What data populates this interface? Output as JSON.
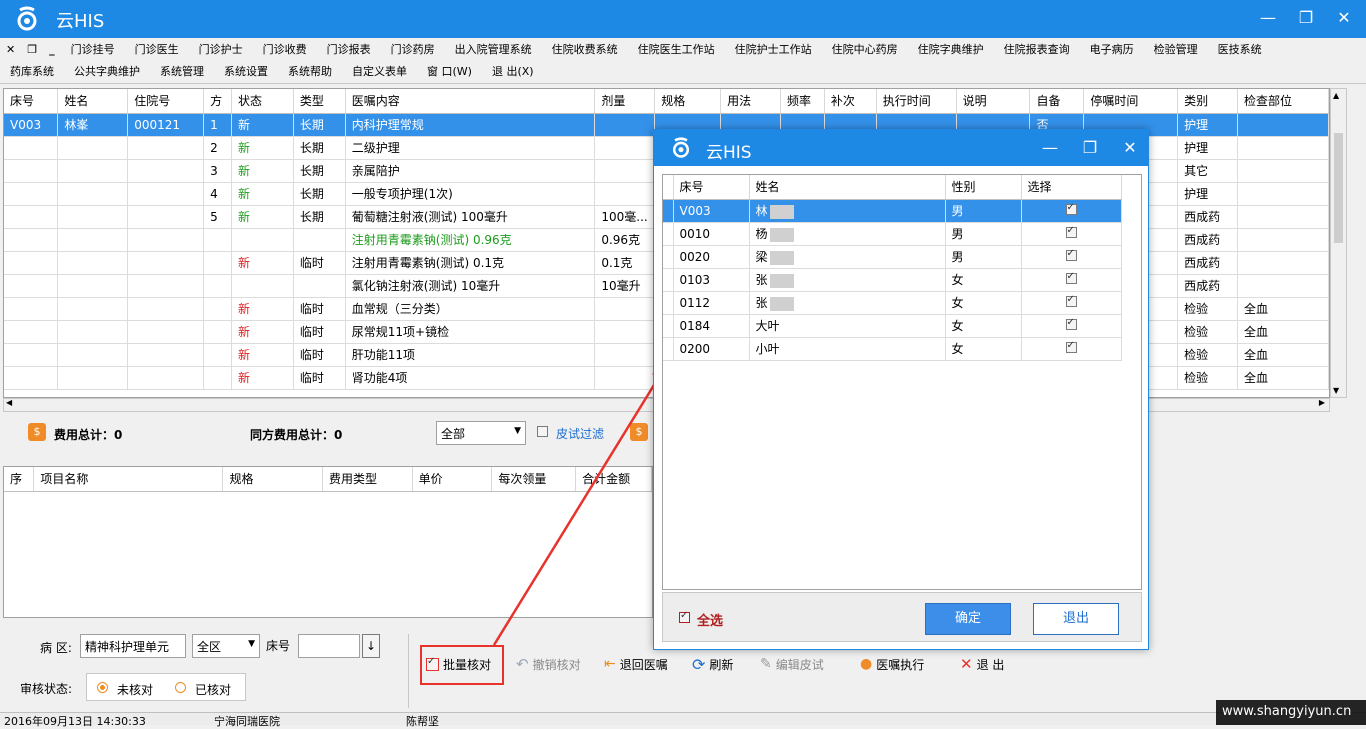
{
  "app": {
    "title": "云HIS"
  },
  "menu": {
    "row1": [
      "门诊挂号",
      "门诊医生",
      "门诊护士",
      "门诊收费",
      "门诊报表",
      "门诊药房",
      "出入院管理系统",
      "住院收费系统",
      "住院医生工作站",
      "住院护士工作站",
      "住院中心药房",
      "住院字典维护",
      "住院报表查询",
      "电子病历",
      "检验管理",
      "医技系统"
    ],
    "row2": [
      "药库系统",
      "公共字典维护",
      "系统管理",
      "系统设置",
      "系统帮助",
      "自定义表单",
      "窗  口(W)",
      "退  出(X)"
    ]
  },
  "orders": {
    "columns": [
      "床号",
      "姓名",
      "住院号",
      "方",
      "状态",
      "类型",
      "医嘱内容",
      "剂量",
      "规格",
      "用法",
      "频率",
      "补次",
      "执行时间",
      "说明",
      "自备",
      "停嘱时间",
      "类别",
      "检查部位"
    ],
    "rows": [
      [
        "V003",
        "林峯",
        "000121",
        "1",
        "新",
        "长期",
        "内科护理常规",
        "",
        "",
        "",
        "",
        "",
        "",
        "",
        "否",
        "",
        "护理",
        ""
      ],
      [
        "",
        "",
        "",
        "2",
        "新",
        "长期",
        "二级护理",
        "",
        "",
        "",
        "",
        "",
        "",
        "",
        "",
        "",
        "护理",
        ""
      ],
      [
        "",
        "",
        "",
        "3",
        "新",
        "长期",
        "亲属陪护",
        "",
        "",
        "",
        "",
        "",
        "",
        "",
        "",
        "",
        "其它",
        ""
      ],
      [
        "",
        "",
        "",
        "4",
        "新",
        "长期",
        "一般专项护理(1次)",
        "",
        "",
        "",
        "",
        "",
        "",
        "",
        "",
        "",
        "护理",
        ""
      ],
      [
        "",
        "",
        "",
        "5",
        "新",
        "长期",
        "葡萄糖注射液(测试) 100毫升",
        "100毫...",
        "",
        "",
        "",
        "",
        "",
        "",
        "",
        "",
        "西成药",
        ""
      ],
      [
        "",
        "",
        "",
        "",
        "",
        "",
        "注射用青霉素钠(测试) 0.96克",
        "0.96克",
        "",
        "",
        "",
        "",
        "",
        "",
        "",
        "",
        "西成药",
        ""
      ],
      [
        "",
        "",
        "",
        "",
        "新",
        "临时",
        "注射用青霉素钠(测试) 0.1克",
        "0.1克",
        "",
        "",
        "",
        "",
        "",
        "",
        "",
        "",
        "西成药",
        ""
      ],
      [
        "",
        "",
        "",
        "",
        "",
        "",
        "氯化钠注射液(测试) 10毫升",
        "10毫升",
        "",
        "",
        "",
        "",
        "",
        "",
        "",
        "",
        "西成药",
        ""
      ],
      [
        "",
        "",
        "",
        "",
        "新",
        "临时",
        "血常规（三分类）",
        "",
        "",
        "",
        "",
        "",
        "",
        "",
        "",
        "",
        "检验",
        "全血"
      ],
      [
        "",
        "",
        "",
        "",
        "新",
        "临时",
        "尿常规11项+镜检",
        "",
        "",
        "",
        "",
        "",
        "",
        "",
        "",
        "",
        "检验",
        "全血"
      ],
      [
        "",
        "",
        "",
        "",
        "新",
        "临时",
        "肝功能11项",
        "",
        "",
        "",
        "",
        "",
        "",
        "",
        "",
        "",
        "检验",
        "全血"
      ],
      [
        "",
        "",
        "",
        "",
        "新",
        "临时",
        "肾功能4项",
        "",
        "",
        "",
        "",
        "",
        "",
        "",
        "",
        "",
        "检验",
        "全血"
      ]
    ]
  },
  "summary": {
    "total_label": "费用总计：0",
    "same_label": "同方费用总计：0",
    "filter_value": "全部",
    "skin_filter": "皮试过滤"
  },
  "fees": {
    "columns": [
      "序",
      "项目名称",
      "规格",
      "费用类型",
      "单价",
      "每次领量",
      "合计金额"
    ]
  },
  "bottom": {
    "ward_label": "病 区:",
    "ward_value": "精神科护理单元",
    "area_value": "全区",
    "bed_label": "床号",
    "audit_label": "审核状态:",
    "radio_unchecked": "未核对",
    "radio_checked": "已核对",
    "btn_batch": "批量核对",
    "btn_undo": "撤销核对",
    "btn_return": "退回医嘱",
    "btn_refresh": "刷新",
    "btn_edit_skin": "编辑皮试",
    "btn_exec": "医嘱执行",
    "btn_exit": "退 出"
  },
  "status": {
    "datetime": "2016年09月13日 14:30:33",
    "hospital": "宁海同瑞医院",
    "user": "陈帮坚"
  },
  "watermark": "www.shangyiyun.cn",
  "dialog": {
    "title": "云HIS",
    "columns": [
      "床号",
      "姓名",
      "性别",
      "选择"
    ],
    "rows": [
      {
        "bed": "V003",
        "name": "林",
        "sex": "男",
        "checked": true
      },
      {
        "bed": "0010",
        "name": "杨",
        "sex": "男",
        "checked": true
      },
      {
        "bed": "0020",
        "name": "梁",
        "sex": "男",
        "checked": true
      },
      {
        "bed": "0103",
        "name": "张",
        "sex": "女",
        "checked": true
      },
      {
        "bed": "0112",
        "name": "张",
        "sex": "女",
        "checked": true
      },
      {
        "bed": "0184",
        "name": "大叶",
        "sex": "女",
        "checked": true
      },
      {
        "bed": "0200",
        "name": "小叶",
        "sex": "女",
        "checked": true
      }
    ],
    "select_all": "全选",
    "ok": "确定",
    "cancel": "退出"
  },
  "colors": {
    "title_blue": "#1e88e5",
    "selection": "#3391ea",
    "new_green": "#20a020",
    "new_red": "#e02020",
    "annotation_red": "#e8332c"
  }
}
